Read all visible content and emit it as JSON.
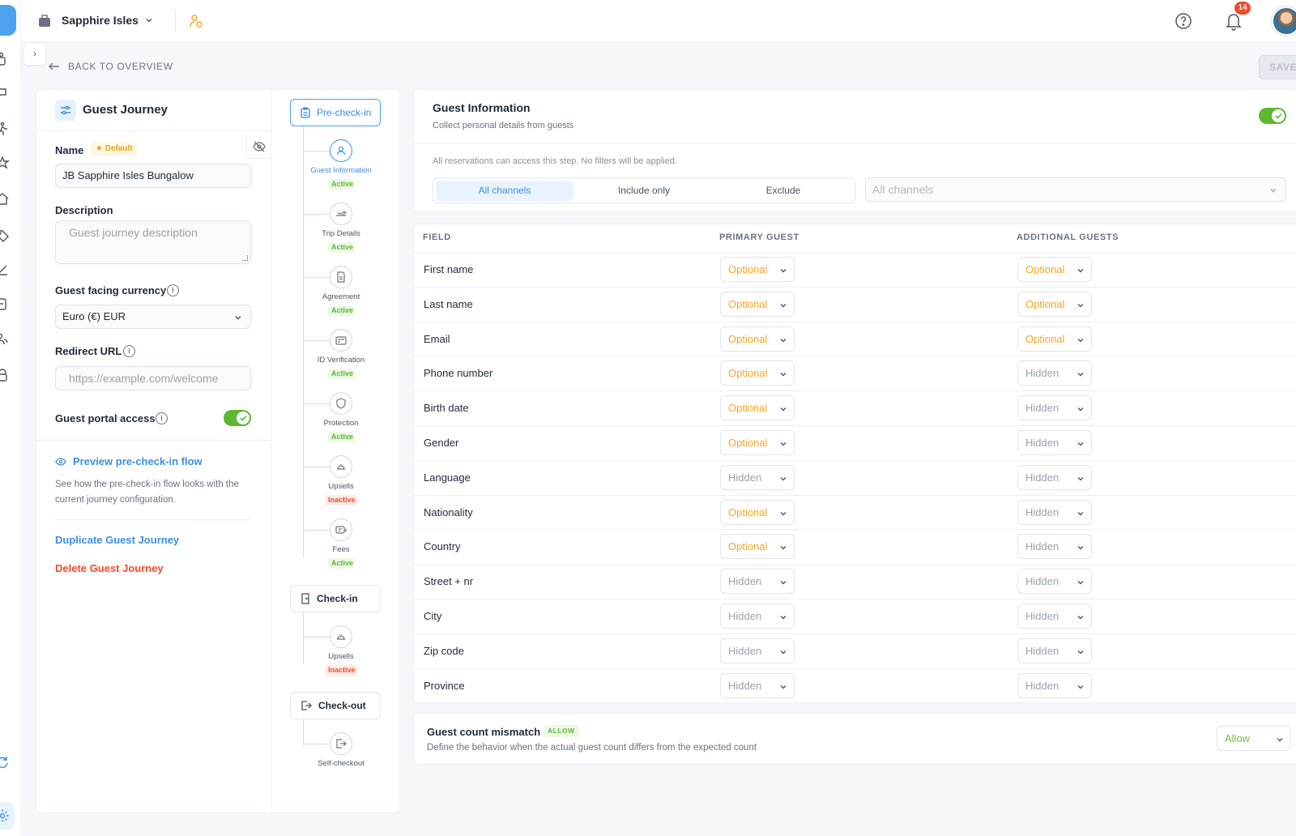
{
  "topbar": {
    "property_name": "Sapphire Isles",
    "notification_count": "14"
  },
  "nav": {
    "back_label": "BACK TO OVERVIEW",
    "save_label": "SAVE"
  },
  "journey": {
    "title": "Guest Journey",
    "name_label": "Name",
    "default_badge": "Default",
    "name_value": "JB Sapphire Isles Bungalow",
    "description_label": "Description",
    "description_placeholder": "Guest journey description",
    "currency_label": "Guest facing currency",
    "currency_value": "Euro (€) EUR",
    "redirect_label": "Redirect URL",
    "redirect_placeholder": "https://example.com/welcome",
    "portal_label": "Guest portal access",
    "portal_enabled": true,
    "preview_link": "Preview pre-check-in flow",
    "preview_desc": "See how the pre-check-in flow looks with the current journey configuration.",
    "duplicate_label": "Duplicate Guest Journey",
    "delete_label": "Delete Guest Journey"
  },
  "stepper": {
    "precheckin_label": "Pre-check-in",
    "checkin_label": "Check-in",
    "checkout_label": "Check-out",
    "steps": [
      {
        "label": "Guest Information",
        "status": "Active",
        "icon": "user-icon"
      },
      {
        "label": "Trip Details",
        "status": "Active",
        "icon": "plane-icon"
      },
      {
        "label": "Agreement",
        "status": "Active",
        "icon": "document-icon"
      },
      {
        "label": "ID Verification",
        "status": "Active",
        "icon": "id-card-icon"
      },
      {
        "label": "Protection",
        "status": "Active",
        "icon": "shield-icon"
      },
      {
        "label": "Upsells",
        "status": "Inactive",
        "icon": "cloche-icon"
      },
      {
        "label": "Fees",
        "status": "Active",
        "icon": "fees-icon"
      }
    ],
    "checkin_steps": [
      {
        "label": "Upsells",
        "status": "Inactive",
        "icon": "cloche-icon"
      }
    ],
    "checkout_steps": [
      {
        "label": "Self-checkout",
        "icon": "exit-icon"
      }
    ]
  },
  "guest_info": {
    "title": "Guest Information",
    "subtitle": "Collect personal details from guests",
    "enabled": true,
    "note": "All reservations can access this step. No filters will be applied.",
    "segments": [
      "All channels",
      "Include only",
      "Exclude"
    ],
    "selected_segment": "All channels",
    "channel_placeholder": "All channels"
  },
  "fields_table": {
    "headers": [
      "FIELD",
      "PRIMARY GUEST",
      "ADDITIONAL GUESTS"
    ],
    "rows": [
      {
        "field": "First name",
        "primary": "Optional",
        "additional": "Optional"
      },
      {
        "field": "Last name",
        "primary": "Optional",
        "additional": "Optional"
      },
      {
        "field": "Email",
        "primary": "Optional",
        "additional": "Optional"
      },
      {
        "field": "Phone number",
        "primary": "Optional",
        "additional": "Hidden"
      },
      {
        "field": "Birth date",
        "primary": "Optional",
        "additional": "Hidden"
      },
      {
        "field": "Gender",
        "primary": "Optional",
        "additional": "Hidden"
      },
      {
        "field": "Language",
        "primary": "Hidden",
        "additional": "Hidden"
      },
      {
        "field": "Nationality",
        "primary": "Optional",
        "additional": "Hidden"
      },
      {
        "field": "Country",
        "primary": "Optional",
        "additional": "Hidden"
      },
      {
        "field": "Street + nr",
        "primary": "Hidden",
        "additional": "Hidden"
      },
      {
        "field": "City",
        "primary": "Hidden",
        "additional": "Hidden"
      },
      {
        "field": "Zip code",
        "primary": "Hidden",
        "additional": "Hidden"
      },
      {
        "field": "Province",
        "primary": "Hidden",
        "additional": "Hidden"
      }
    ]
  },
  "mismatch": {
    "title": "Guest count mismatch",
    "badge": "ALLOW",
    "description": "Define the behavior when the actual guest count differs from the expected count",
    "value": "Allow"
  },
  "colors": {
    "accent": "#3b8fe0",
    "optional": "#f5a623",
    "hidden": "#9aa1ac",
    "success": "#5cb82e",
    "danger": "#ef4b2c"
  }
}
